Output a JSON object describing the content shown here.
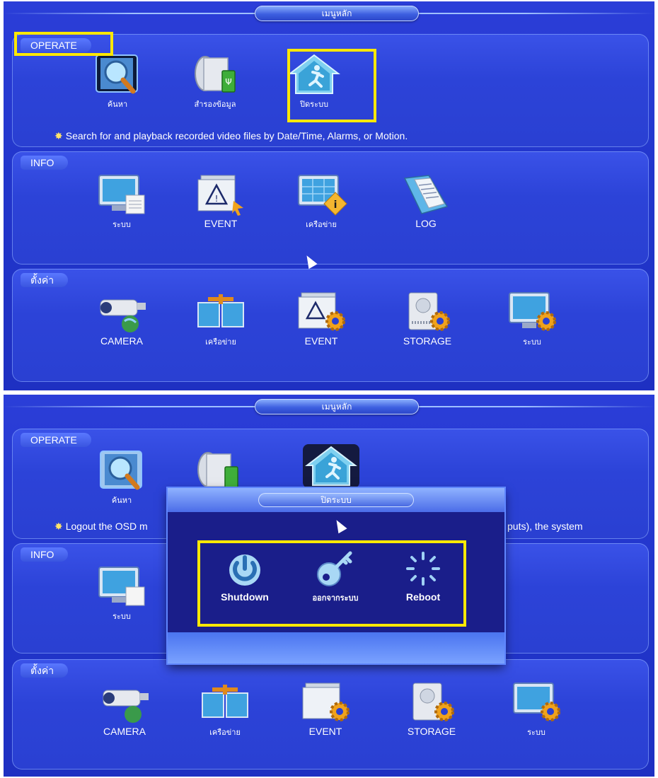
{
  "screen1": {
    "title": "เมนูหลัก",
    "operate": {
      "header": "OPERATE",
      "items": [
        {
          "label": "ค้นหา",
          "icon": "search-playback-icon"
        },
        {
          "label": "สำรองข้อมูล",
          "icon": "backup-usb-icon"
        },
        {
          "label": "ปิดระบบ",
          "icon": "shutdown-house-icon"
        }
      ],
      "hint": "Search for and playback recorded video files by Date/Time, Alarms, or Motion."
    },
    "info": {
      "header": "INFO",
      "items": [
        {
          "label": "ระบบ",
          "icon": "system-info-icon"
        },
        {
          "label": "EVENT",
          "icon": "event-warning-icon"
        },
        {
          "label": "เครือข่าย",
          "icon": "network-info-icon"
        },
        {
          "label": "LOG",
          "icon": "log-book-icon"
        }
      ]
    },
    "settings": {
      "header": "ตั้งค่า",
      "items": [
        {
          "label": "CAMERA",
          "icon": "camera-icon"
        },
        {
          "label": "เครือข่าย",
          "icon": "network-settings-icon"
        },
        {
          "label": "EVENT",
          "icon": "event-settings-icon"
        },
        {
          "label": "STORAGE",
          "icon": "storage-settings-icon"
        },
        {
          "label": "ระบบ",
          "icon": "system-settings-icon"
        }
      ]
    }
  },
  "screen2": {
    "title": "เมนูหลัก",
    "operate": {
      "header": "OPERATE",
      "items": [
        {
          "label": "ค้นหา",
          "icon": "search-playback-icon"
        }
      ],
      "hint_left": "Logout the OSD m",
      "hint_right": "puts), the system"
    },
    "info": {
      "header": "INFO",
      "items": [
        {
          "label": "ระบบ",
          "icon": "system-info-icon"
        }
      ]
    },
    "settings": {
      "header": "ตั้งค่า",
      "items": [
        {
          "label": "CAMERA",
          "icon": "camera-icon"
        },
        {
          "label": "เครือข่าย",
          "icon": "network-settings-icon"
        },
        {
          "label": "EVENT",
          "icon": "event-settings-icon"
        },
        {
          "label": "STORAGE",
          "icon": "storage-settings-icon"
        },
        {
          "label": "ระบบ",
          "icon": "system-settings-icon"
        }
      ]
    },
    "dialog": {
      "title": "ปิดระบบ",
      "options": [
        {
          "label": "Shutdown",
          "icon": "power-icon"
        },
        {
          "label": "ออกจากระบบ",
          "icon": "key-logout-icon"
        },
        {
          "label": "Reboot",
          "icon": "reboot-spinner-icon"
        }
      ]
    }
  },
  "colors": {
    "background": "#2236cc",
    "highlight": "#ffe800",
    "dialog_bg": "#1a1e8a"
  }
}
